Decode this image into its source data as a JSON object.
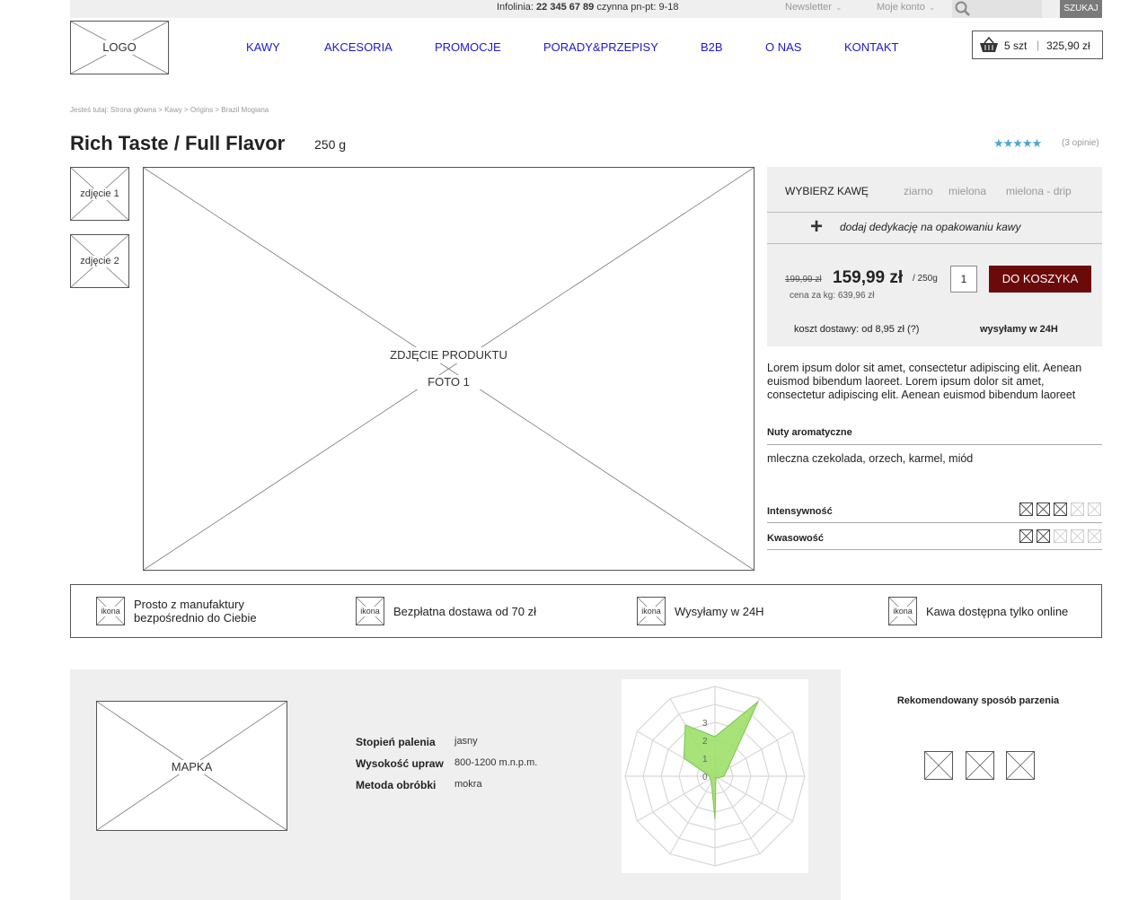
{
  "topbar": {
    "hotline_label": "Infolinia:",
    "hotline_number": "22 345 67 89",
    "hotline_hours": "czynna pn-pt: 9-18",
    "newsletter": "Newsletter",
    "account": "Moje konto",
    "search_button": "SZUKAJ"
  },
  "header": {
    "logo": "LOGO",
    "nav": [
      "KAWY",
      "AKCESORIA",
      "PROMOCJE",
      "PORADY&PRZEPISY",
      "B2B",
      "O NAS",
      "KONTAKT"
    ],
    "cart_count": "5 szt",
    "cart_total": "325,90 zł"
  },
  "breadcrumb": "Jesteś tutaj: Strona główna > Kawy > Origins > Brazil Mogiana",
  "product": {
    "title": "Rich Taste / Full Flavor",
    "weight": "250 g",
    "rating": 5,
    "stars": "★★★★★",
    "reviews": "(3 opinie)",
    "thumb1": "zdjęcie 1",
    "thumb2": "zdjęcie 2",
    "photo_line1": "ZDJĘCIE PRODUKTU",
    "photo_line2": "FOTO 1"
  },
  "panel": {
    "choose": "WYBIERZ KAWĘ",
    "options": [
      "ziarno",
      "mielona",
      "mielona - drip"
    ],
    "dedication": "dodaj dedykację na opakowaniu kawy",
    "old_price": "199,99 zł",
    "price": "159,99 zł",
    "per": "/ 250g",
    "per_kg": "cena za kg: 639,96 zł",
    "quantity": "1",
    "add_to_cart": "DO KOSZYKA",
    "shipping": "koszt dostawy: od 8,95 zł (?)",
    "ships_24h": "wysyłamy w 24H"
  },
  "description": "Lorem ipsum dolor sit amet, consectetur adipiscing elit. Aenean euismod bibendum laoreet. Lorem ipsum dolor sit amet, consectetur adipiscing elit. Aenean euismod bibendum laoreet",
  "aroma": {
    "heading": "Nuty aromatyczne",
    "notes": "mleczna czekolada, orzech, karmel, miód"
  },
  "attributes": [
    {
      "label": "Intensywność",
      "value": 3,
      "max": 5
    },
    {
      "label": "Kwasowość",
      "value": 2,
      "max": 5
    }
  ],
  "features": [
    {
      "icon": "ikona",
      "text_line1": "Prosto z manufaktury",
      "text_line2": "bezpośrednio do Ciebie"
    },
    {
      "icon": "ikona",
      "text_line1": "Bezpłatna dostawa od 70 zł",
      "text_line2": ""
    },
    {
      "icon": "ikona",
      "text_line1": "Wysyłamy w 24H",
      "text_line2": ""
    },
    {
      "icon": "ikona",
      "text_line1": "Kawa dostępna tylko online",
      "text_line2": ""
    }
  ],
  "origin": {
    "map": "MAPKA",
    "specs": [
      {
        "label": "Stopień palenia",
        "value": "jasny"
      },
      {
        "label": "Wysokość upraw",
        "value": "800-1200 m.n.p.m."
      },
      {
        "label": "Metoda obróbki",
        "value": "mokra"
      }
    ]
  },
  "chart_data": {
    "type": "radar",
    "axes_count": 12,
    "ticks": [
      "0",
      "1",
      "2",
      "3"
    ],
    "rmax": 5,
    "values": [
      2.2,
      4.8,
      0.8,
      0.5,
      0.2,
      0.1,
      2.4,
      0.4,
      0.3,
      0.3,
      2.0,
      3.3
    ],
    "fill_color": "#9ee06b",
    "stroke_color": "#7bc44a"
  },
  "brewing": {
    "title": "Rekomendowany sposób parzenia",
    "icons": 3
  }
}
